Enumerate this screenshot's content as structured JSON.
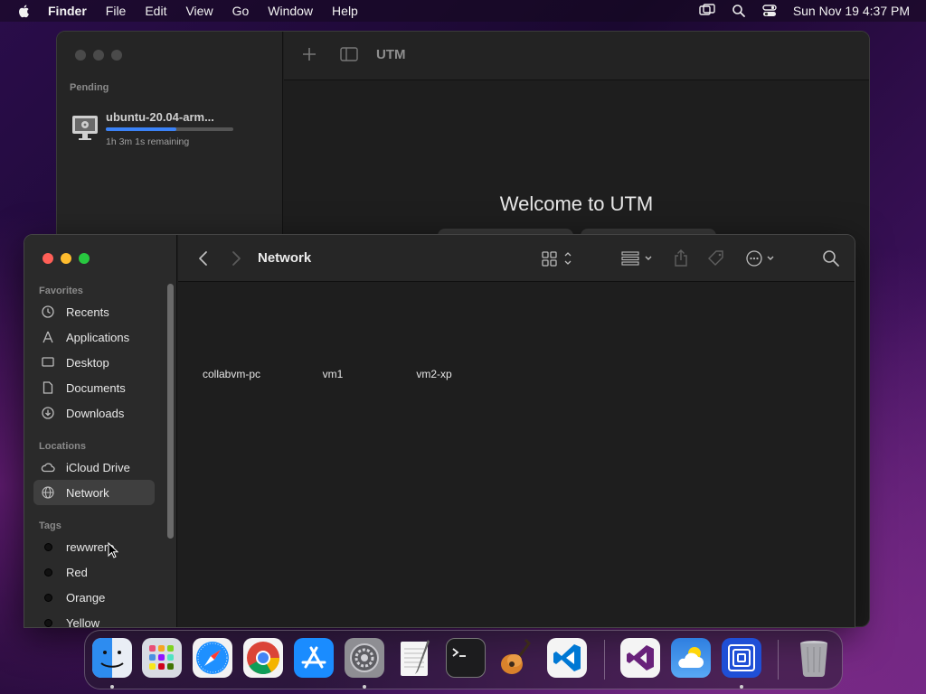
{
  "menubar": {
    "app": "Finder",
    "items": [
      "File",
      "Edit",
      "View",
      "Go",
      "Window",
      "Help"
    ],
    "clock": "Sun Nov 19  4:37 PM",
    "icons": [
      "apple-icon",
      "screen-mirroring-icon",
      "spotlight-search-icon",
      "control-center-icon"
    ]
  },
  "utm": {
    "title": "UTM",
    "pending_label": "Pending",
    "vm_name": "ubuntu-20.04-arm...",
    "remaining": "1h 3m 1s remaining",
    "progress": 0.55,
    "welcome": "Welcome to UTM"
  },
  "finder": {
    "title": "Network",
    "sections": {
      "favorites": "Favorites",
      "locations": "Locations",
      "tags": "Tags"
    },
    "favorites": [
      "Recents",
      "Applications",
      "Desktop",
      "Documents",
      "Downloads"
    ],
    "locations": [
      "iCloud Drive",
      "Network"
    ],
    "tags": [
      "rewwrere",
      "Red",
      "Orange",
      "Yellow"
    ],
    "files": [
      "collabvm-pc",
      "vm1",
      "vm2-xp"
    ]
  },
  "dock": {
    "apps": [
      "Finder",
      "Launchpad",
      "Safari",
      "Google Chrome",
      "App Store",
      "System Preferences",
      "TextEdit",
      "Terminal",
      "GarageBand",
      "Visual Studio Code",
      "Visual Studio",
      "Weather",
      "UTM",
      "Trash"
    ],
    "accent": "#0a84ff"
  }
}
